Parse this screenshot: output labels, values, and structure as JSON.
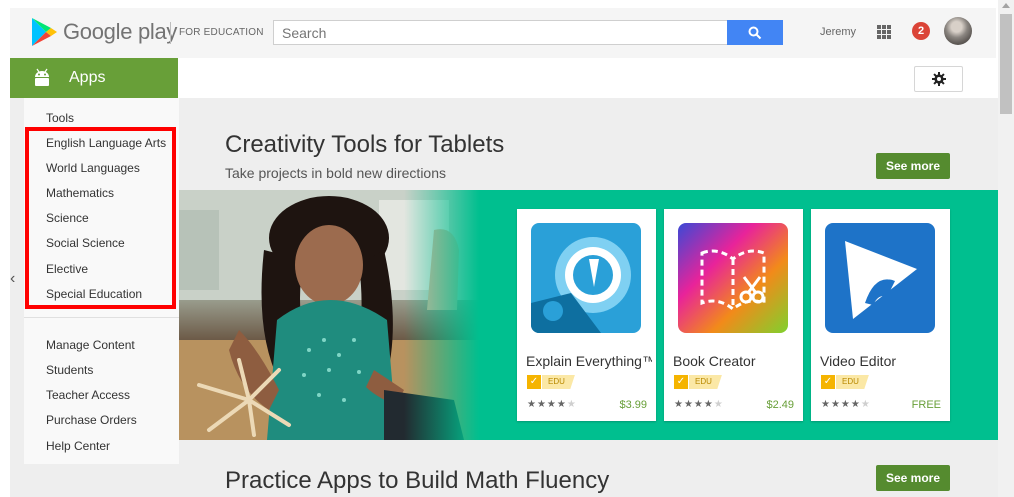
{
  "header": {
    "logo_text": "Google play",
    "edu_label": "FOR EDUCATION",
    "search_placeholder": "Search",
    "user_name": "Jeremy",
    "notification_count": "2"
  },
  "sidebar": {
    "section_label": "Apps",
    "categories": [
      "Tools",
      "English Language Arts",
      "World Languages",
      "Mathematics",
      "Science",
      "Social Science",
      "Elective",
      "Special Education"
    ],
    "admin_items": [
      "Manage Content",
      "Students",
      "Teacher Access",
      "Purchase Orders",
      "Help Center"
    ],
    "nav_prev": "‹"
  },
  "sections": [
    {
      "title": "Creativity Tools for Tablets",
      "subtitle": "Take projects in bold new directions",
      "see_more": "See more"
    },
    {
      "title": "Practice Apps to Build Math Fluency",
      "see_more": "See more"
    }
  ],
  "cards": [
    {
      "title": "Explain Everything™",
      "badge": "EDU",
      "rating": 4,
      "price": "$3.99",
      "icon": "explain-everything-icon"
    },
    {
      "title": "Book Creator",
      "badge": "EDU",
      "rating": 4,
      "price": "$2.49",
      "icon": "book-creator-icon"
    },
    {
      "title": "Video Editor",
      "badge": "EDU",
      "rating": 4,
      "price": "FREE",
      "icon": "video-editor-icon"
    }
  ],
  "colors": {
    "apps_green": "#689f38",
    "see_more_green": "#558b2f",
    "banner_teal": "#00bf8f",
    "search_blue": "#4285f4",
    "highlight_red": "#ff0000"
  }
}
